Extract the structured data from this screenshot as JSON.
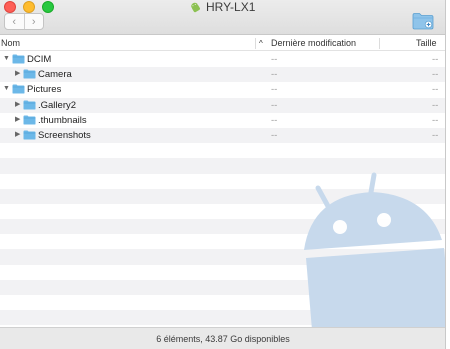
{
  "window": {
    "title": "HRY-LX1"
  },
  "toolbar": {
    "back_glyph": "‹",
    "forward_glyph": "›",
    "new_folder_icon": "folder-plus-icon"
  },
  "columns": {
    "name": "Nom",
    "modified": "Dernière modification",
    "size": "Taille"
  },
  "rows": [
    {
      "name": "DCIM",
      "modified": "--",
      "size": "--",
      "expanded": true,
      "depth": 0
    },
    {
      "name": "Camera",
      "modified": "--",
      "size": "--",
      "expanded": false,
      "depth": 1
    },
    {
      "name": "Pictures",
      "modified": "--",
      "size": "--",
      "expanded": true,
      "depth": 0
    },
    {
      "name": ".Gallery2",
      "modified": "--",
      "size": "--",
      "expanded": false,
      "depth": 1
    },
    {
      "name": ".thumbnails",
      "modified": "--",
      "size": "--",
      "expanded": false,
      "depth": 1
    },
    {
      "name": "Screenshots",
      "modified": "--",
      "size": "--",
      "expanded": false,
      "depth": 1
    }
  ],
  "status": {
    "text": "6 éléments, 43.87 Go disponibles"
  },
  "colors": {
    "folder": "#6cb8e8",
    "android_watermark": "#c5d8ec",
    "close": "#fe5f57",
    "minimize": "#febc2e",
    "maximize": "#28c840"
  }
}
